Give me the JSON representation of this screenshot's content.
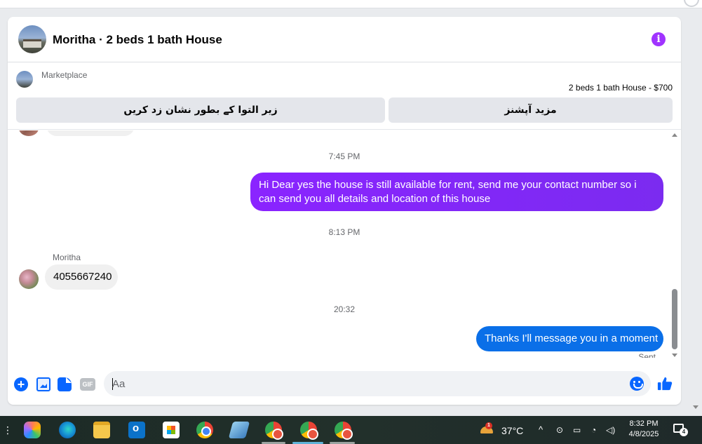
{
  "header": {
    "title": "Moritha · 2 beds 1 bath House",
    "info_icon_label": "i"
  },
  "marketplace": {
    "label": "Marketplace",
    "listing": "2 beds 1 bath House - $700",
    "buttons": {
      "left": "زیر التوا کے بطور نشان زد کریں",
      "right": "مزید آپشنز"
    }
  },
  "messages": {
    "time1": "7:45 PM",
    "outgoing1": "Hi Dear yes the house is still available for rent, send me your contact number so i can send you all details and location of this house",
    "time2": "8:13 PM",
    "incoming_sender": "Moritha",
    "incoming1": "4055667240",
    "time3": "20:32",
    "outgoing2": "Thanks I'll message you in a moment",
    "status": "Sent"
  },
  "composer": {
    "placeholder": "Aa",
    "gif_label": "GIF",
    "plus_label": "+"
  },
  "taskbar": {
    "temperature": "37°C",
    "time": "8:32 PM",
    "date": "4/8/2025",
    "weather_badge": "1",
    "notification_count": "4"
  },
  "colors": {
    "outgoing_purple": "#8a24ff",
    "outgoing_blue": "#0a6fe8",
    "messenger_blue": "#0866ff",
    "info_purple": "#a033ff"
  }
}
